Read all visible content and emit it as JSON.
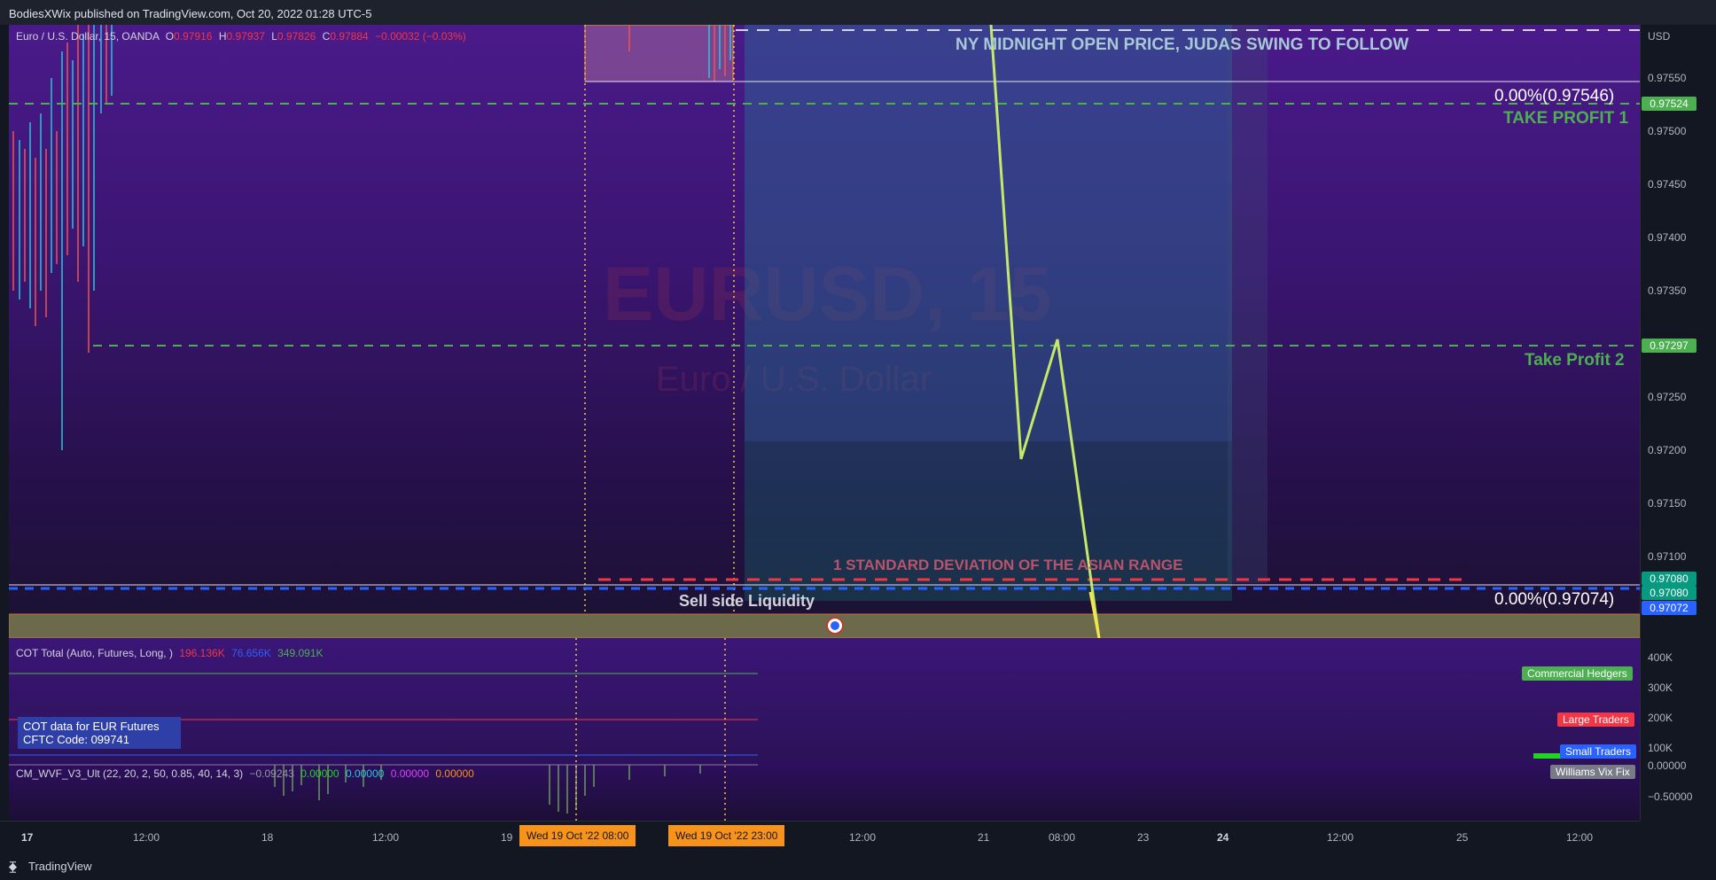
{
  "header": {
    "published_text": "BodiesXWix published on TradingView.com, Oct 20, 2022 01:28 UTC-5"
  },
  "symbol_legend": {
    "name": "Euro / U.S. Dollar, 15, OANDA",
    "o_label": "O",
    "o_value": "0.97916",
    "h_label": "H",
    "h_value": "0.97937",
    "l_label": "L",
    "l_value": "0.97826",
    "c_label": "C",
    "c_value": "0.97884",
    "change": "−0.00032 (−0.03%)"
  },
  "watermark": {
    "symbol": "EURUSD, 15",
    "description": "Euro / U.S. Dollar"
  },
  "annotations": {
    "ny_midnight": "NY MIDNIGHT OPEN PRICE, JUDAS SWING TO FOLLOW",
    "fib_top": "0.00%(0.97546)",
    "take_profit_1": "TAKE PROFIT 1",
    "take_profit_2": "Take Profit 2",
    "std_dev": "1 STANDARD DEVIATION OF THE ASIAN RANGE",
    "sell_side": "Sell side Liquidity",
    "fib_bottom": "0.00%(0.97074)"
  },
  "price_axis": {
    "currency": "USD",
    "ticks": [
      "0.97550",
      "0.97500",
      "0.97450",
      "0.97400",
      "0.97350",
      "0.97250",
      "0.97200",
      "0.97150",
      "0.97100"
    ],
    "tags": {
      "tp1": "0.97524",
      "tp2": "0.97297",
      "t1": "0.97080",
      "t2": "0.97080",
      "t3": "0.97072"
    }
  },
  "cot": {
    "title": "COT Total (Auto, Futures, Long, )",
    "v1": "196.136K",
    "v2": "76.656K",
    "v3": "349.091K",
    "info_line1": "COT data for EUR Futures",
    "info_line2": "CFTC Code: 099741",
    "axis": [
      "400K",
      "300K",
      "200K",
      "100K"
    ],
    "labels": {
      "commercial": "Commercial Hedgers",
      "large": "Large Traders",
      "small": "Small Traders"
    }
  },
  "wvf": {
    "title": "CM_WVF_V3_Ult (22, 20, 2, 50, 0.85, 40, 14, 3)",
    "v1": "−0.09243",
    "v2": "0.00000",
    "v3": "0.00000",
    "v4": "0.00000",
    "v5": "0.00000",
    "axis": [
      "0.00000",
      "−0.50000"
    ],
    "label": "Williams Vix Fix"
  },
  "time_axis": {
    "labels": [
      "17",
      "12:00",
      "18",
      "12:00",
      "19",
      "12:00",
      "21",
      "08:00",
      "23",
      "24",
      "12:00",
      "25",
      "12:00"
    ],
    "tag1": "Wed 19 Oct '22   08:00",
    "tag2": "Wed 19 Oct '22   23:00"
  },
  "footer": {
    "brand": "TradingView"
  },
  "colors": {
    "green": "#4caf50",
    "red": "#f23645",
    "blue": "#2962ff",
    "orange": "#f7931a",
    "yellow_line": "#c6e86a"
  }
}
